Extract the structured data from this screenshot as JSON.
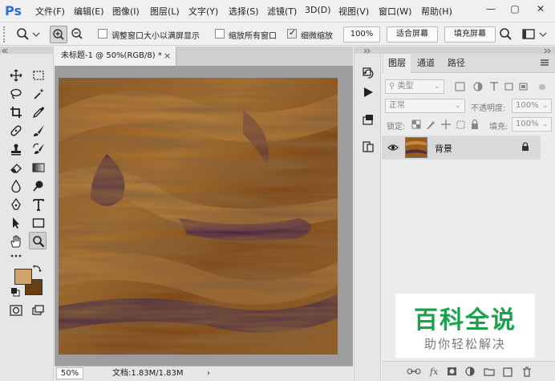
{
  "app": {
    "logo": "Ps"
  },
  "menu": [
    "文件(F)",
    "编辑(E)",
    "图像(I)",
    "图层(L)",
    "文字(Y)",
    "选择(S)",
    "滤镜(T)",
    "3D(D)",
    "视图(V)",
    "窗口(W)",
    "帮助(H)"
  ],
  "window_controls": {
    "minimize": "—",
    "restore": "▢",
    "close": "✕"
  },
  "options": {
    "resize_windows_label": "调整窗口大小以满屏显示",
    "resize_windows_checked": false,
    "zoom_all_label": "缩放所有窗口",
    "zoom_all_checked": false,
    "scrubby_zoom_label": "细微缩放",
    "scrubby_zoom_checked": true,
    "zoom_100_button": "100%",
    "fit_screen_button": "适合屏幕",
    "fill_screen_button": "填充屏幕"
  },
  "colors": {
    "foreground": "#d2a46b",
    "background": "#6b3d13",
    "accent": "#2a6dd6"
  },
  "document": {
    "tab_title": "未标题-1 @ 50%(RGB/8) *",
    "tab_close": "×",
    "zoom": "50%",
    "doc_info": "文档:1.83M/1.83M",
    "status_arrow": "›"
  },
  "layers_panel": {
    "tabs": [
      "图层",
      "通道",
      "路径"
    ],
    "active_tab": 0,
    "filter_kind": "类型",
    "blend_mode": "正常",
    "opacity_label": "不透明度:",
    "opacity_value": "100%",
    "lock_label": "锁定:",
    "fill_label": "填充:",
    "fill_value": "100%",
    "layers": [
      {
        "name": "背景",
        "visible": true,
        "locked": true
      }
    ]
  },
  "watermark": {
    "title": "百科全说",
    "subtitle": "助你轻松解决"
  }
}
